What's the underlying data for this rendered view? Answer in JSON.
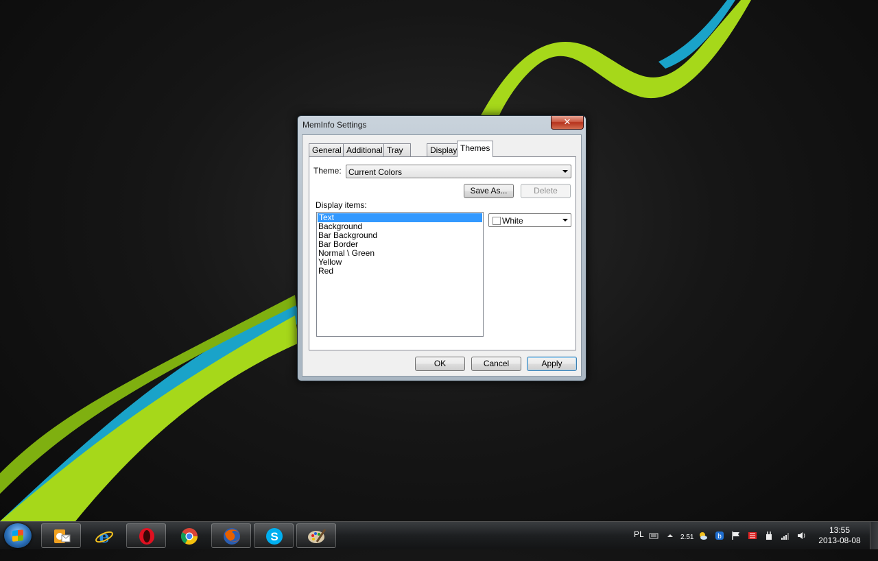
{
  "window": {
    "title": "MemInfo Settings",
    "close_label": "✕"
  },
  "tabs": [
    {
      "label": "General",
      "active": false
    },
    {
      "label": "Additional",
      "active": false
    },
    {
      "label": "Tray Menu",
      "active": false
    },
    {
      "label": "Display",
      "active": false
    },
    {
      "label": "Themes",
      "active": true
    }
  ],
  "themes": {
    "theme_label": "Theme:",
    "theme_value": "Current Colors",
    "save_as_label": "Save As...",
    "delete_label": "Delete",
    "display_items_label": "Display items:",
    "display_items": [
      "Text",
      "Background",
      "Bar Background",
      "Bar Border",
      "Normal \\ Green",
      "Yellow",
      "Red"
    ],
    "selected_item": "Text",
    "color_value": "White"
  },
  "buttons": {
    "ok": "OK",
    "cancel": "Cancel",
    "apply": "Apply"
  },
  "taskbar": {
    "apps": [
      "outlook-icon",
      "internet-explorer-icon",
      "opera-icon",
      "chrome-icon",
      "firefox-icon",
      "skype-icon",
      "paint-icon"
    ],
    "language": "PL",
    "network_indicator": "2.51",
    "time": "13:55",
    "date": "2013-08-08"
  },
  "colors": {
    "selection": "#3399ff",
    "accent_green": "#a6d81a",
    "accent_blue": "#1aa3c9"
  }
}
